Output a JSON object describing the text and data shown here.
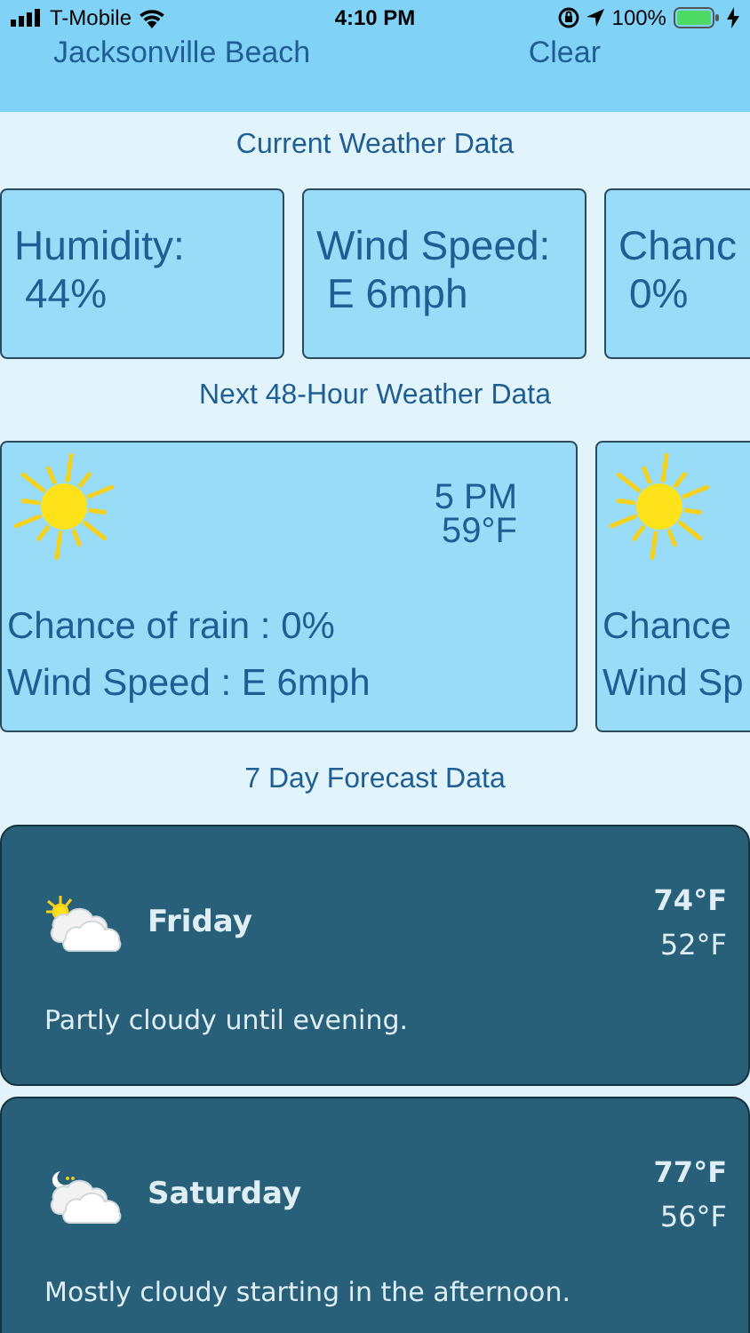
{
  "status_bar": {
    "carrier": "T-Mobile",
    "time": "4:10 PM",
    "battery": "100%"
  },
  "header": {
    "location": "Jacksonville Beach",
    "condition": "Clear"
  },
  "current": {
    "title": "Current Weather Data",
    "cards": [
      {
        "label": "Humidity:",
        "value": "44%"
      },
      {
        "label": "Wind Speed:",
        "value": "E 6mph"
      },
      {
        "label": "Chanc",
        "value": "0%"
      }
    ]
  },
  "hourly": {
    "title": "Next 48-Hour Weather Data",
    "cards": [
      {
        "time": "5 PM",
        "temp": "59°F",
        "rain": "Chance of rain : 0%",
        "wind": "Wind Speed : E 6mph"
      },
      {
        "rain": "Chance",
        "wind": "Wind Sp"
      }
    ]
  },
  "daily": {
    "title": "7 Day Forecast Data",
    "days": [
      {
        "kind": "day",
        "day": "Friday",
        "high": "74°F",
        "low": "52°F",
        "summary": "Partly cloudy until evening."
      },
      {
        "kind": "night",
        "day": "Saturday",
        "high": "77°F",
        "low": "56°F",
        "summary": "Mostly cloudy starting in the afternoon."
      }
    ]
  }
}
